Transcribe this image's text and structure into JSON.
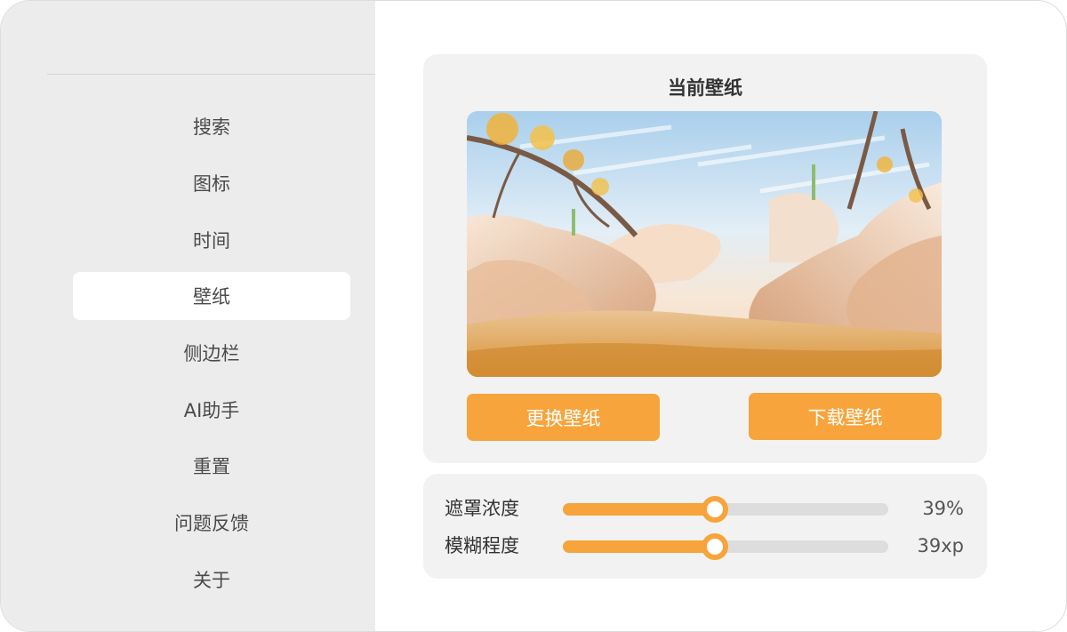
{
  "colors": {
    "accent": "#f6a43b",
    "sidebar_bg": "#ececec",
    "card_bg": "#f2f2f2"
  },
  "sidebar": {
    "items": [
      {
        "id": "search",
        "label": "搜索",
        "active": false
      },
      {
        "id": "icons",
        "label": "图标",
        "active": false
      },
      {
        "id": "time",
        "label": "时间",
        "active": false
      },
      {
        "id": "wallpaper",
        "label": "壁纸",
        "active": true
      },
      {
        "id": "sidebar",
        "label": "侧边栏",
        "active": false
      },
      {
        "id": "ai-assistant",
        "label": "AI助手",
        "active": false
      },
      {
        "id": "reset",
        "label": "重置",
        "active": false
      },
      {
        "id": "feedback",
        "label": "问题反馈",
        "active": false
      },
      {
        "id": "about",
        "label": "关于",
        "active": false
      }
    ]
  },
  "wallpaper": {
    "title": "当前壁纸",
    "change_label": "更换壁纸",
    "download_label": "下载壁纸"
  },
  "sliders": [
    {
      "id": "mask-opacity",
      "label": "遮罩浓度",
      "value": 39,
      "display": "39%"
    },
    {
      "id": "blur",
      "label": "模糊程度",
      "value": 39,
      "display": "39xp"
    }
  ]
}
